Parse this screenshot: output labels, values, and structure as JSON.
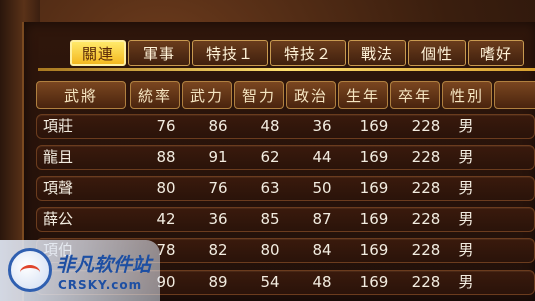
{
  "tabs": [
    {
      "label": "關連",
      "active": true
    },
    {
      "label": "軍事",
      "active": false
    },
    {
      "label": "特技１",
      "active": false
    },
    {
      "label": "特技２",
      "active": false
    },
    {
      "label": "戰法",
      "active": false
    },
    {
      "label": "個性",
      "active": false
    },
    {
      "label": "嗜好",
      "active": false
    }
  ],
  "columns": [
    "武將",
    "統率",
    "武力",
    "智力",
    "政治",
    "生年",
    "卒年",
    "性別"
  ],
  "rows": [
    [
      "項莊",
      "76",
      "86",
      "48",
      "36",
      "169",
      "228",
      "男"
    ],
    [
      "龍且",
      "88",
      "91",
      "62",
      "44",
      "169",
      "228",
      "男"
    ],
    [
      "項聲",
      "80",
      "76",
      "63",
      "50",
      "169",
      "228",
      "男"
    ],
    [
      "薛公",
      "42",
      "36",
      "85",
      "87",
      "169",
      "228",
      "男"
    ],
    [
      "項伯",
      "78",
      "82",
      "80",
      "84",
      "169",
      "228",
      "男"
    ],
    [
      "",
      "90",
      "89",
      "54",
      "48",
      "169",
      "228",
      "男"
    ]
  ],
  "watermark": {
    "title": "非凡软件站",
    "url": "CRSKY.com"
  },
  "colors": {
    "active_tab": "#f4b820",
    "panel_bg": "#2f160b",
    "text": "#f2ece0"
  }
}
